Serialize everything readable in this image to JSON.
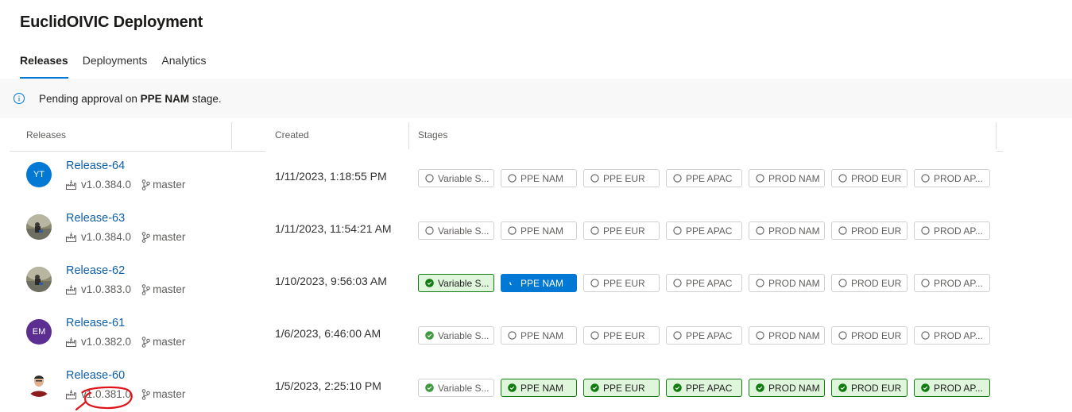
{
  "page": {
    "title": "EuclidOIVIC Deployment"
  },
  "tabs": [
    {
      "label": "Releases",
      "active": true
    },
    {
      "label": "Deployments",
      "active": false
    },
    {
      "label": "Analytics",
      "active": false
    }
  ],
  "banner": {
    "icon": "info-icon",
    "prefix": "Pending approval on ",
    "stage": "PPE NAM",
    "suffix": " stage."
  },
  "table": {
    "headers": {
      "releases": "Releases",
      "created": "Created",
      "stages": "Stages"
    },
    "rows": [
      {
        "name": "Release-64",
        "avatar": {
          "type": "initials",
          "text": "YT",
          "color": "#0078d4"
        },
        "version": "v1.0.384.0",
        "branch": "master",
        "created": "1/11/2023, 1:18:55 PM",
        "stages": [
          {
            "label": "Variable S...",
            "status": "not-deployed"
          },
          {
            "label": "PPE NAM",
            "status": "not-deployed"
          },
          {
            "label": "PPE EUR",
            "status": "not-deployed"
          },
          {
            "label": "PPE APAC",
            "status": "not-deployed"
          },
          {
            "label": "PROD NAM",
            "status": "not-deployed"
          },
          {
            "label": "PROD EUR",
            "status": "not-deployed"
          },
          {
            "label": "PROD AP...",
            "status": "not-deployed"
          }
        ]
      },
      {
        "name": "Release-63",
        "avatar": {
          "type": "photo",
          "text": ""
        },
        "version": "v1.0.384.0",
        "branch": "master",
        "created": "1/11/2023, 11:54:21 AM",
        "stages": [
          {
            "label": "Variable S...",
            "status": "not-deployed"
          },
          {
            "label": "PPE NAM",
            "status": "not-deployed"
          },
          {
            "label": "PPE EUR",
            "status": "not-deployed"
          },
          {
            "label": "PPE APAC",
            "status": "not-deployed"
          },
          {
            "label": "PROD NAM",
            "status": "not-deployed"
          },
          {
            "label": "PROD EUR",
            "status": "not-deployed"
          },
          {
            "label": "PROD AP...",
            "status": "not-deployed"
          }
        ]
      },
      {
        "name": "Release-62",
        "avatar": {
          "type": "photo",
          "text": ""
        },
        "version": "v1.0.383.0",
        "branch": "master",
        "created": "1/10/2023, 9:56:03 AM",
        "stages": [
          {
            "label": "Variable S...",
            "status": "succeeded"
          },
          {
            "label": "PPE NAM",
            "status": "in-progress"
          },
          {
            "label": "PPE EUR",
            "status": "not-deployed"
          },
          {
            "label": "PPE APAC",
            "status": "not-deployed"
          },
          {
            "label": "PROD NAM",
            "status": "not-deployed"
          },
          {
            "label": "PROD EUR",
            "status": "not-deployed"
          },
          {
            "label": "PROD AP...",
            "status": "not-deployed"
          }
        ]
      },
      {
        "name": "Release-61",
        "avatar": {
          "type": "initials",
          "text": "EM",
          "color": "#5c2e91"
        },
        "version": "v1.0.382.0",
        "branch": "master",
        "created": "1/6/2023, 6:46:00 AM",
        "stages": [
          {
            "label": "Variable S...",
            "status": "succeeded-faint"
          },
          {
            "label": "PPE NAM",
            "status": "not-deployed"
          },
          {
            "label": "PPE EUR",
            "status": "not-deployed"
          },
          {
            "label": "PPE APAC",
            "status": "not-deployed"
          },
          {
            "label": "PROD NAM",
            "status": "not-deployed"
          },
          {
            "label": "PROD EUR",
            "status": "not-deployed"
          },
          {
            "label": "PROD AP...",
            "status": "not-deployed"
          }
        ]
      },
      {
        "name": "Release-60",
        "avatar": {
          "type": "person",
          "text": ""
        },
        "version": "v1.0.381.0",
        "branch": "master",
        "created": "1/5/2023, 2:25:10 PM",
        "stages": [
          {
            "label": "Variable S...",
            "status": "succeeded-faint"
          },
          {
            "label": "PPE NAM",
            "status": "succeeded"
          },
          {
            "label": "PPE EUR",
            "status": "succeeded"
          },
          {
            "label": "PPE APAC",
            "status": "succeeded"
          },
          {
            "label": "PROD NAM",
            "status": "succeeded"
          },
          {
            "label": "PROD EUR",
            "status": "succeeded"
          },
          {
            "label": "PROD AP...",
            "status": "succeeded"
          }
        ]
      }
    ]
  },
  "colors": {
    "accent": "#0078d4",
    "link": "#0f5fa8",
    "success": "#107c10",
    "success_bg": "#dff6dd",
    "annotation": "#e0131a"
  }
}
